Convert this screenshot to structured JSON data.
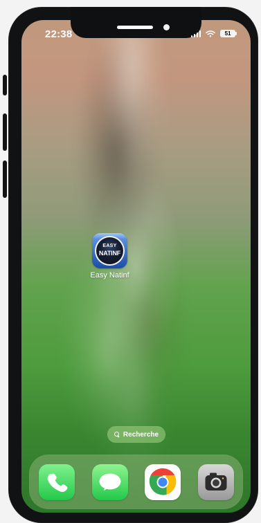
{
  "status_bar": {
    "time": "22:38",
    "battery_text": "51"
  },
  "home_screen": {
    "app": {
      "label": "Easy Natinf",
      "icon_text_top": "EASY",
      "icon_text_bottom": "NATINF"
    },
    "search": {
      "label": "Recherche"
    }
  },
  "dock": {
    "apps": [
      {
        "icon": "phone-icon"
      },
      {
        "icon": "messages-icon"
      },
      {
        "icon": "chrome-icon"
      },
      {
        "icon": "camera-icon"
      }
    ]
  },
  "colors": {
    "phone_frame": "#111214",
    "status_text": "#ffffff",
    "search_pill": "#97c97c",
    "dock_background": "#8db478"
  }
}
